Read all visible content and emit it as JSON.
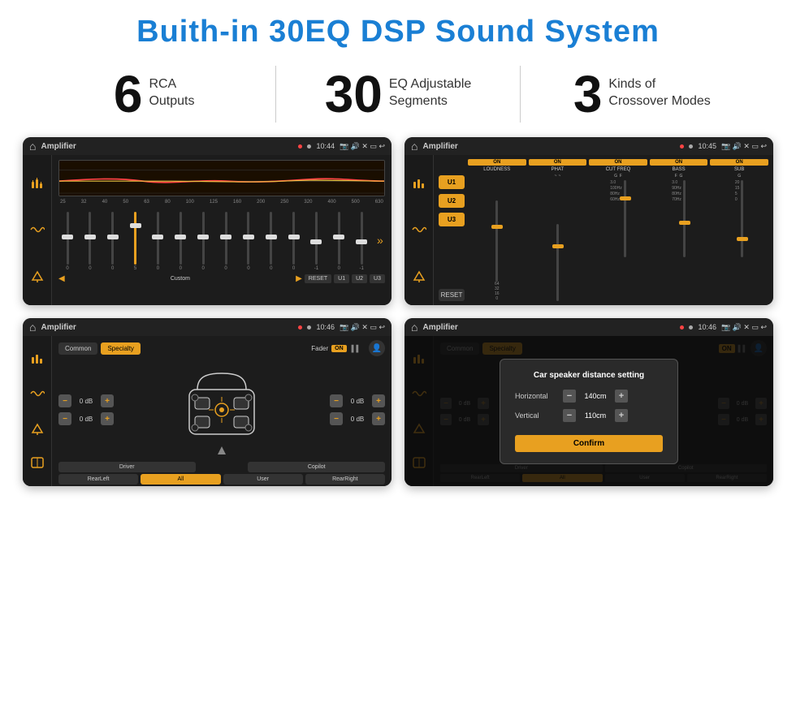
{
  "header": {
    "title": "Buith-in 30EQ DSP Sound System"
  },
  "stats": [
    {
      "number": "6",
      "line1": "RCA",
      "line2": "Outputs"
    },
    {
      "number": "30",
      "line1": "EQ Adjustable",
      "line2": "Segments"
    },
    {
      "number": "3",
      "line1": "Kinds of",
      "line2": "Crossover Modes"
    }
  ],
  "screens": [
    {
      "id": "eq-screen",
      "statusbar": {
        "home": "⌂",
        "app": "Amplifier",
        "time": "10:44"
      }
    },
    {
      "id": "crossover-screen",
      "statusbar": {
        "home": "⌂",
        "app": "Amplifier",
        "time": "10:45"
      }
    },
    {
      "id": "fader-screen",
      "statusbar": {
        "home": "⌂",
        "app": "Amplifier",
        "time": "10:46"
      }
    },
    {
      "id": "dialog-screen",
      "statusbar": {
        "home": "⌂",
        "app": "Amplifier",
        "time": "10:46"
      },
      "dialog": {
        "title": "Car speaker distance setting",
        "horizontal_label": "Horizontal",
        "horizontal_value": "140cm",
        "vertical_label": "Vertical",
        "vertical_value": "110cm",
        "confirm_label": "Confirm"
      }
    }
  ],
  "eq": {
    "freqs": [
      "25",
      "32",
      "40",
      "50",
      "63",
      "80",
      "100",
      "125",
      "160",
      "200",
      "250",
      "320",
      "400",
      "500",
      "630"
    ],
    "values": [
      "0",
      "0",
      "0",
      "5",
      "0",
      "0",
      "0",
      "0",
      "0",
      "0",
      "0",
      "-1",
      "0",
      "-1"
    ],
    "preset": "Custom",
    "buttons": [
      "RESET",
      "U1",
      "U2",
      "U3"
    ]
  },
  "crossover": {
    "presets": [
      "U1",
      "U2",
      "U3"
    ],
    "channels": [
      {
        "label": "LOUDNESS",
        "state": "ON"
      },
      {
        "label": "PHAT",
        "state": "ON"
      },
      {
        "label": "CUT FREQ",
        "state": "ON"
      },
      {
        "label": "BASS",
        "state": "ON"
      },
      {
        "label": "SUB",
        "state": "ON"
      }
    ],
    "reset_label": "RESET"
  },
  "fader": {
    "tabs": [
      "Common",
      "Specialty"
    ],
    "active_tab": "Specialty",
    "fader_label": "Fader",
    "fader_on": "ON",
    "sections": [
      {
        "label": "Driver",
        "db": "0 dB"
      },
      {
        "label": "Copilot",
        "db": "0 dB"
      },
      {
        "label": "RearLeft",
        "db": "0 dB"
      },
      {
        "label": "RearRight",
        "db": "0 dB"
      }
    ],
    "bottom_buttons": [
      "Driver",
      "Copilot",
      "RearLeft",
      "All",
      "User",
      "RearRight"
    ]
  },
  "dialog": {
    "title": "Car speaker distance setting",
    "horizontal_label": "Horizontal",
    "horizontal_value": "140cm",
    "vertical_label": "Vertical",
    "vertical_value": "110cm",
    "confirm_label": "Confirm"
  }
}
